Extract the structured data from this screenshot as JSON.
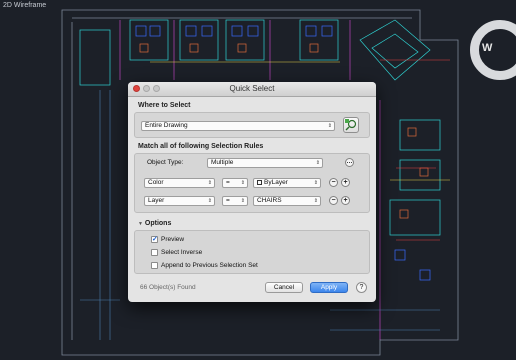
{
  "viewport": {
    "label": "2D Wireframe",
    "compass_letter": "W"
  },
  "dialog": {
    "title": "Quick Select",
    "where_label": "Where to Select",
    "where_value": "Entire Drawing",
    "match_label": "Match all of following Selection Rules",
    "object_type_label": "Object Type:",
    "object_type_value": "Multiple",
    "rules": [
      {
        "property": "Color",
        "operator": "=",
        "value": "ByLayer"
      },
      {
        "property": "Layer",
        "operator": "=",
        "value": "CHAIRS"
      }
    ],
    "options_label": "Options",
    "options": [
      {
        "label": "Preview",
        "checked": true
      },
      {
        "label": "Select Inverse",
        "checked": false
      },
      {
        "label": "Append to Previous Selection Set",
        "checked": false
      }
    ],
    "found_text": "66 Object(s) Found",
    "cancel_label": "Cancel",
    "apply_label": "Apply",
    "help_label": "?"
  },
  "colors": {
    "apply_blue": "#3c86ec",
    "background": "#1c2028",
    "close_red": "#e0443e"
  }
}
